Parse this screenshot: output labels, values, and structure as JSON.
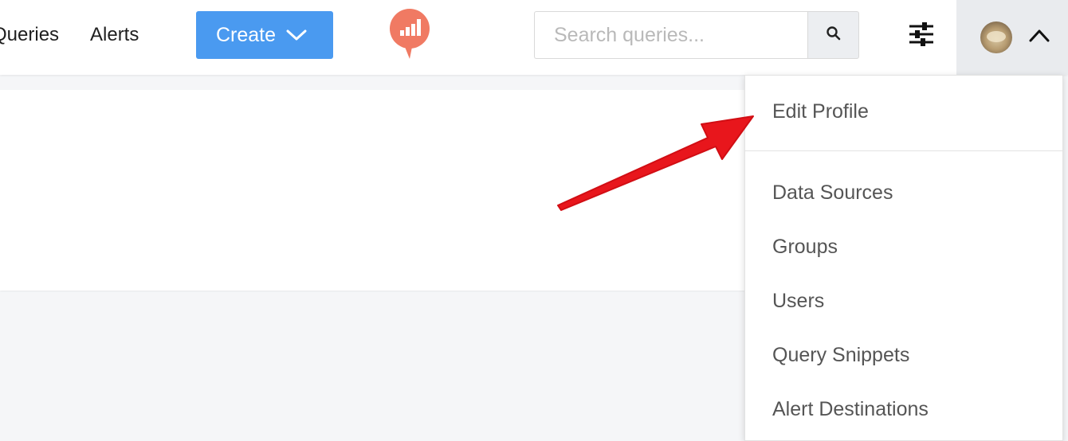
{
  "nav": {
    "queries_label": "Queries",
    "alerts_label": "Alerts",
    "create_label": "Create"
  },
  "search": {
    "placeholder": "Search queries...",
    "value": ""
  },
  "user_menu": {
    "items": [
      {
        "label": "Edit Profile"
      },
      {
        "label": "Data Sources"
      },
      {
        "label": "Groups"
      },
      {
        "label": "Users"
      },
      {
        "label": "Query Snippets"
      },
      {
        "label": "Alert Destinations"
      }
    ]
  },
  "colors": {
    "create_button": "#4a9af0",
    "logo": "#f07a63",
    "annotation_arrow": "#e8161c",
    "page_background": "#f5f6f8"
  },
  "icons": {
    "logo": "redash-logo-icon",
    "create_chevron": "chevron-down-icon",
    "search": "search-icon",
    "settings": "sliders-icon",
    "user_menu_toggle": "chevron-up-icon",
    "annotation": "red-arrow-annotation"
  }
}
